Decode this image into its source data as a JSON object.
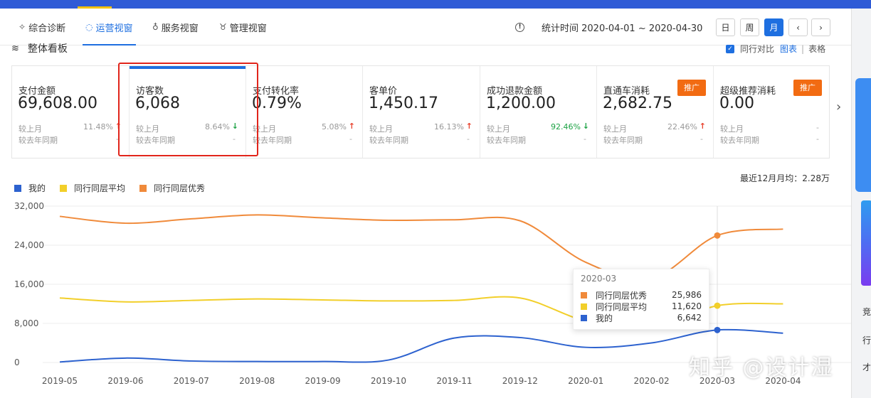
{
  "nav": {
    "tabs": [
      {
        "label": "综合诊断",
        "icon": "diagnosis-icon"
      },
      {
        "label": "运营视窗",
        "icon": "operation-icon"
      },
      {
        "label": "服务视窗",
        "icon": "headset-icon"
      },
      {
        "label": "管理视窗",
        "icon": "medal-icon"
      }
    ],
    "active_tab": "运营视窗",
    "stat_time": "统计时间 2020-04-01 ~ 2020-04-30",
    "period_buttons": [
      "日",
      "周",
      "月"
    ],
    "active_period": "月",
    "prev_icon": "chevron-left-icon",
    "next_icon": "chevron-right-icon"
  },
  "board": {
    "title": "整体看板",
    "compare_label": "同行对比",
    "compare_checked": true,
    "view_chart": "图表",
    "view_table": "表格",
    "view_sep": "|"
  },
  "cards": [
    {
      "name": "支付金额",
      "value": "69,608.00",
      "r1": "较上月",
      "r2": "较去年同期",
      "pct": "11.48%",
      "trend": "up",
      "r2val": "-"
    },
    {
      "name": "访客数",
      "value": "6,068",
      "r1": "较上月",
      "r2": "较去年同期",
      "pct": "8.64%",
      "trend": "down",
      "r2val": "-"
    },
    {
      "name": "支付转化率",
      "value": "0.79%",
      "r1": "较上月",
      "r2": "较去年同期",
      "pct": "5.08%",
      "trend": "up",
      "r2val": "-"
    },
    {
      "name": "客单价",
      "value": "1,450.17",
      "r1": "较上月",
      "r2": "较去年同期",
      "pct": "16.13%",
      "trend": "up",
      "r2val": "-"
    },
    {
      "name": "成功退款金额",
      "value": "1,200.00",
      "r1": "较上月",
      "r2": "较去年同期",
      "pct": "92.46%",
      "trend": "down",
      "r2val": "-"
    },
    {
      "name": "直通车消耗",
      "value": "2,682.75",
      "r1": "较上月",
      "r2": "较去年同期",
      "pct": "22.46%",
      "trend": "up",
      "r2val": "-",
      "badge": "推广"
    },
    {
      "name": "超级推荐消耗",
      "value": "0.00",
      "r1": "较上月",
      "r2": "较去年同期",
      "pct": "-",
      "trend": "none",
      "r2val": "-",
      "badge": "推广"
    }
  ],
  "avg_label": "最近12月月均：2.28万",
  "colors": {
    "mine": "#2d62cf",
    "avg": "#f2cf2a",
    "best": "#f08a3a",
    "accent": "#1e6fe0"
  },
  "chart_data": {
    "type": "line",
    "categories": [
      "2019-05",
      "2019-06",
      "2019-07",
      "2019-08",
      "2019-09",
      "2019-10",
      "2019-11",
      "2019-12",
      "2020-01",
      "2020-02",
      "2020-03",
      "2020-04"
    ],
    "yticks": [
      "32,000",
      "24,000",
      "16,000",
      "8,000",
      "0"
    ],
    "ylim": [
      0,
      32000
    ],
    "series": [
      {
        "name": "我的",
        "values": [
          100,
          900,
          300,
          200,
          200,
          500,
          5000,
          5100,
          3100,
          4000,
          6642,
          6000
        ]
      },
      {
        "name": "同行同层平均",
        "values": [
          13200,
          12400,
          12700,
          13000,
          12800,
          12600,
          12700,
          13200,
          8500,
          7100,
          11620,
          12000
        ]
      },
      {
        "name": "同行同层优秀",
        "values": [
          29900,
          28500,
          29400,
          30200,
          29600,
          29100,
          29200,
          29000,
          20500,
          17200,
          25986,
          27300
        ]
      }
    ],
    "tooltip": {
      "title": "2020-03",
      "rows": [
        {
          "name": "同行同层优秀",
          "value": "25,986"
        },
        {
          "name": "同行同层平均",
          "value": "11,620"
        },
        {
          "name": "我的",
          "value": "6,642"
        }
      ]
    }
  },
  "watermark": "知乎 @设计湿",
  "sidebar_right": {
    "texts": [
      "竞",
      "行",
      "才"
    ]
  }
}
